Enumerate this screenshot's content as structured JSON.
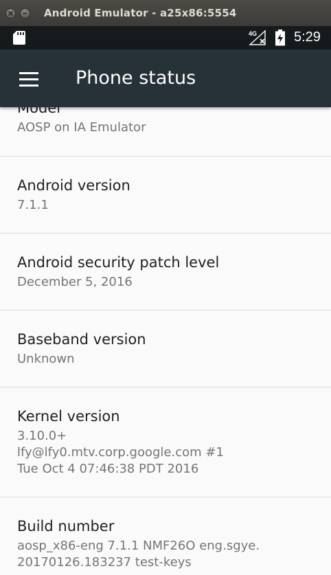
{
  "window": {
    "title": "Android Emulator - a25x86:5554"
  },
  "status_bar": {
    "network": "4G",
    "time": "5:29"
  },
  "app_bar": {
    "title": "Phone status"
  },
  "items": [
    {
      "title": "Model",
      "summary": "AOSP on IA Emulator"
    },
    {
      "title": "Android version",
      "summary": "7.1.1"
    },
    {
      "title": "Android security patch level",
      "summary": "December 5, 2016"
    },
    {
      "title": "Baseband version",
      "summary": "Unknown"
    },
    {
      "title": "Kernel version",
      "summary": "3.10.0+\nlfy@lfy0.mtv.corp.google.com #1\nTue Oct 4 07:46:38 PDT 2016"
    },
    {
      "title": "Build number",
      "summary": "aosp_x86-eng 7.1.1 NMF26O eng.sgye.\n20170126.183237 test-keys"
    }
  ]
}
